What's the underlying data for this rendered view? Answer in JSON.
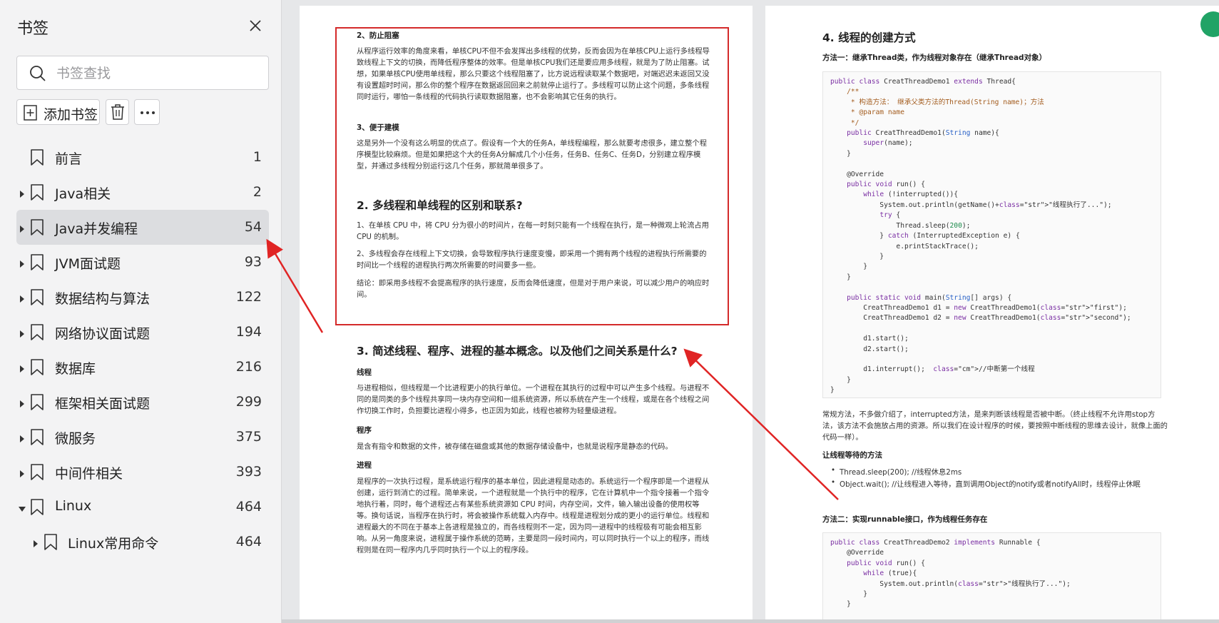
{
  "sidebar": {
    "title": "书签",
    "search_placeholder": "书签查找",
    "add_label": "添加书签",
    "bookmarks": [
      {
        "label": "前言",
        "page": "1",
        "expandable": false,
        "expanded": false,
        "selected": false
      },
      {
        "label": "Java相关",
        "page": "2",
        "expandable": true,
        "expanded": false,
        "selected": false
      },
      {
        "label": "Java并发编程",
        "page": "54",
        "expandable": true,
        "expanded": false,
        "selected": true
      },
      {
        "label": "JVM面试题",
        "page": "93",
        "expandable": true,
        "expanded": false,
        "selected": false
      },
      {
        "label": "数据结构与算法",
        "page": "122",
        "expandable": true,
        "expanded": false,
        "selected": false
      },
      {
        "label": "网络协议面试题",
        "page": "194",
        "expandable": true,
        "expanded": false,
        "selected": false
      },
      {
        "label": "数据库",
        "page": "216",
        "expandable": true,
        "expanded": false,
        "selected": false
      },
      {
        "label": "框架相关面试题",
        "page": "299",
        "expandable": true,
        "expanded": false,
        "selected": false
      },
      {
        "label": "微服务",
        "page": "375",
        "expandable": true,
        "expanded": false,
        "selected": false
      },
      {
        "label": "中间件相关",
        "page": "393",
        "expandable": true,
        "expanded": false,
        "selected": false
      },
      {
        "label": "Linux",
        "page": "464",
        "expandable": true,
        "expanded": true,
        "selected": false
      },
      {
        "label": "Linux常用命令",
        "page": "464",
        "expandable": true,
        "expanded": false,
        "selected": false,
        "child": true
      }
    ]
  },
  "left_page": {
    "s_block_title": "2、防止阻塞",
    "s_block_text": "从程序运行效率的角度来看，单核CPU不但不会发挥出多线程的优势，反而会因为在单核CPU上运行多线程导致线程上下文的切换，而降低程序整体的效率。但是单核CPU我们还是要应用多线程，就是为了防止阻塞。试想，如果单核CPU使用单线程，那么只要这个线程阻塞了，比方说远程读取某个数据吧，对端迟迟未返回又没有设置超时时间，那么你的整个程序在数据返回回来之前就停止运行了。多线程可以防止这个问题，多条线程同时运行，哪怕一条线程的代码执行读取数据阻塞，也不会影响其它任务的执行。",
    "model_title": "3、便于建模",
    "model_text": "这是另外一个没有这么明显的优点了。假设有一个大的任务A，单线程编程，那么就要考虑很多，建立整个程序模型比较麻烦。但是如果把这个大的任务A分解成几个小任务，任务B、任务C、任务D，分别建立程序模型，并通过多线程分别运行这几个任务，那就简单很多了。",
    "h2_diff": "2. 多线程和单线程的区别和联系?",
    "diff_1": "1、在单核 CPU 中，将 CPU 分为很小的时间片，在每一时刻只能有一个线程在执行，是一种微观上轮流占用 CPU 的机制。",
    "diff_2": "2、多线程会存在线程上下文切换，会导致程序执行速度变慢，即采用一个拥有两个线程的进程执行所需要的时间比一个线程的进程执行两次所需要的时间要多一些。",
    "diff_conclusion": "结论：即采用多线程不会提高程序的执行速度，反而会降低速度，但是对于用户来说，可以减少用户的响应时间。",
    "h2_concept": "3. 简述线程、程序、进程的基本概念。以及他们之间关系是什么?",
    "thread_title": "线程",
    "thread_text": "与进程相似，但线程是一个比进程更小的执行单位。一个进程在其执行的过程中可以产生多个线程。与进程不同的是同类的多个线程共享同一块内存空间和一组系统资源，所以系统在产生一个线程，或是在各个线程之间作切换工作时，负担要比进程小得多，也正因为如此，线程也被称为轻量级进程。",
    "program_title": "程序",
    "program_text": "是含有指令和数据的文件，被存储在磁盘或其他的数据存储设备中，也就是说程序是静态的代码。",
    "process_title": "进程",
    "process_text": "是程序的一次执行过程，是系统运行程序的基本单位，因此进程是动态的。系统运行一个程序即是一个进程从创建，运行到消亡的过程。简单来说，一个进程就是一个执行中的程序，它在计算机中一个指令接着一个指令地执行着，同时，每个进程还占有某些系统资源如 CPU 时间，内存空间，文件，输入输出设备的使用权等等。换句话说，当程序在执行时，将会被操作系统载入内存中。线程是进程划分成的更小的运行单位。线程和进程最大的不同在于基本上各进程是独立的，而各线程则不一定，因为同一进程中的线程极有可能会相互影响。从另一角度来说，进程属于操作系统的范畴，主要是同一段时间内，可以同时执行一个以上的程序，而线程则是在同一程序内几乎同时执行一个以上的程序段。"
  },
  "right_page": {
    "h2_create": "4. 线程的创建方式",
    "method1_title": "方法一：继承Thread类，作为线程对象存在（继承Thread对象）",
    "code1_lines": [
      "public class CreatThreadDemo1 extends Thread{",
      "    /**",
      "     * 构造方法： 继承父类方法的Thread(String name)；方法",
      "     * @param name",
      "     */",
      "    public CreatThreadDemo1(String name){",
      "        super(name);",
      "    }",
      "",
      "    @Override",
      "    public void run() {",
      "        while (!interrupted()){",
      "            System.out.println(getName()+\"线程执行了...\");",
      "            try {",
      "                Thread.sleep(200);",
      "            } catch (InterruptedException e) {",
      "                e.printStackTrace();",
      "            }",
      "        }",
      "    }",
      "",
      "    public static void main(String[] args) {",
      "        CreatThreadDemo1 d1 = new CreatThreadDemo1(\"first\");",
      "        CreatThreadDemo1 d2 = new CreatThreadDemo1(\"second\");",
      "",
      "        d1.start();",
      "        d2.start();",
      "",
      "        d1.interrupt();  //中断第一个线程",
      "    }",
      "}"
    ],
    "method1_desc": "常规方法，不多做介绍了，interrupted方法，是来判断该线程是否被中断。（终止线程不允许用stop方法，该方法不会施放占用的资源。所以我们在设计程序的时候，要按照中断线程的思维去设计，就像上面的代码一样）。",
    "wait_title": "让线程等待的方法",
    "bullets": [
      "Thread.sleep(200); //线程休息2ms",
      "Object.wait();   //让线程进入等待，直到调用Object的notify或者notifyAll时，线程停止休眠"
    ],
    "method2_title": "方法二：实现runnable接口，作为线程任务存在",
    "code2_lines": [
      "public class CreatThreadDemo2 implements Runnable {",
      "    @Override",
      "    public void run() {",
      "        while (true){",
      "            System.out.println(\"线程执行了...\");",
      "        }",
      "    }"
    ]
  },
  "colors": {
    "accent_red": "#d42a2a",
    "selected_bg": "#dcdde0",
    "corner_icon": "#21a366"
  },
  "icons": [
    "close-icon",
    "search-icon",
    "add-bookmark-icon",
    "trash-icon",
    "more-icon",
    "bookmark-icon",
    "caret-right-icon",
    "caret-down-icon"
  ]
}
